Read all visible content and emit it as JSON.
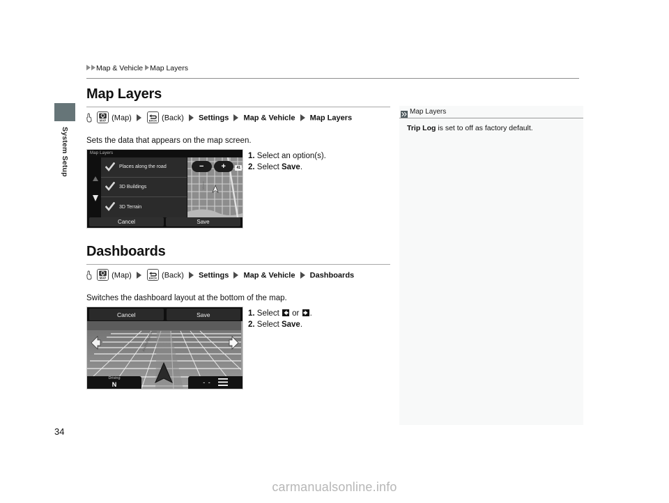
{
  "document": {
    "page_number": "34",
    "side_tab_label": "System Setup",
    "watermark": "carmanualsonline.info"
  },
  "breadcrumb": {
    "item1": "Map & Vehicle",
    "item2": "Map Layers"
  },
  "sections": [
    {
      "title": "Map Layers",
      "nav_path": {
        "map_label": "(Map)",
        "back_label": "(Back)",
        "settings": "Settings",
        "map_vehicle": "Map & Vehicle",
        "destination": "Map Layers",
        "map_button_text": "MAP",
        "back_button_text": "BACK"
      },
      "description": "Sets the data that appears on the map screen.",
      "steps": [
        {
          "num": "1.",
          "text_before": "Select an option(s).",
          "bold": "",
          "text_after": ""
        },
        {
          "num": "2.",
          "text_before": "Select ",
          "bold": "Save",
          "text_after": "."
        }
      ],
      "screenshot": {
        "title": "Map Layers",
        "options": [
          {
            "label": "Places along the road",
            "checked": true
          },
          {
            "label": "3D Buildings",
            "checked": true
          },
          {
            "label": "3D Terrain",
            "checked": true
          }
        ],
        "zoom_out": "−",
        "zoom_in": "+",
        "scale_badge": "41",
        "cancel": "Cancel",
        "save": "Save"
      }
    },
    {
      "title": "Dashboards",
      "nav_path": {
        "map_label": "(Map)",
        "back_label": "(Back)",
        "settings": "Settings",
        "map_vehicle": "Map & Vehicle",
        "destination": "Dashboards",
        "map_button_text": "MAP",
        "back_button_text": "BACK"
      },
      "description": "Switches the dashboard layout at the bottom of the map.",
      "steps": [
        {
          "num": "1.",
          "text_before": "Select ",
          "bold": "",
          "text_after": " or "
        },
        {
          "num": "2.",
          "text_before": "Select ",
          "bold": "Save",
          "text_after": "."
        }
      ],
      "screenshot": {
        "cancel": "Cancel",
        "save": "Save",
        "driving_label": "Driving",
        "heading": "N",
        "eta_placeholder": "- -"
      }
    }
  ],
  "note": {
    "title": "Map Layers",
    "bold_term": "Trip Log",
    "text": " is set to off as factory default."
  },
  "colors": {
    "side_tab": "#667578",
    "rule": "#8d8d8d",
    "note_background": "#f8f9f9",
    "watermark": "#b7b7b7",
    "device_bezel": "#0f0f0f"
  }
}
